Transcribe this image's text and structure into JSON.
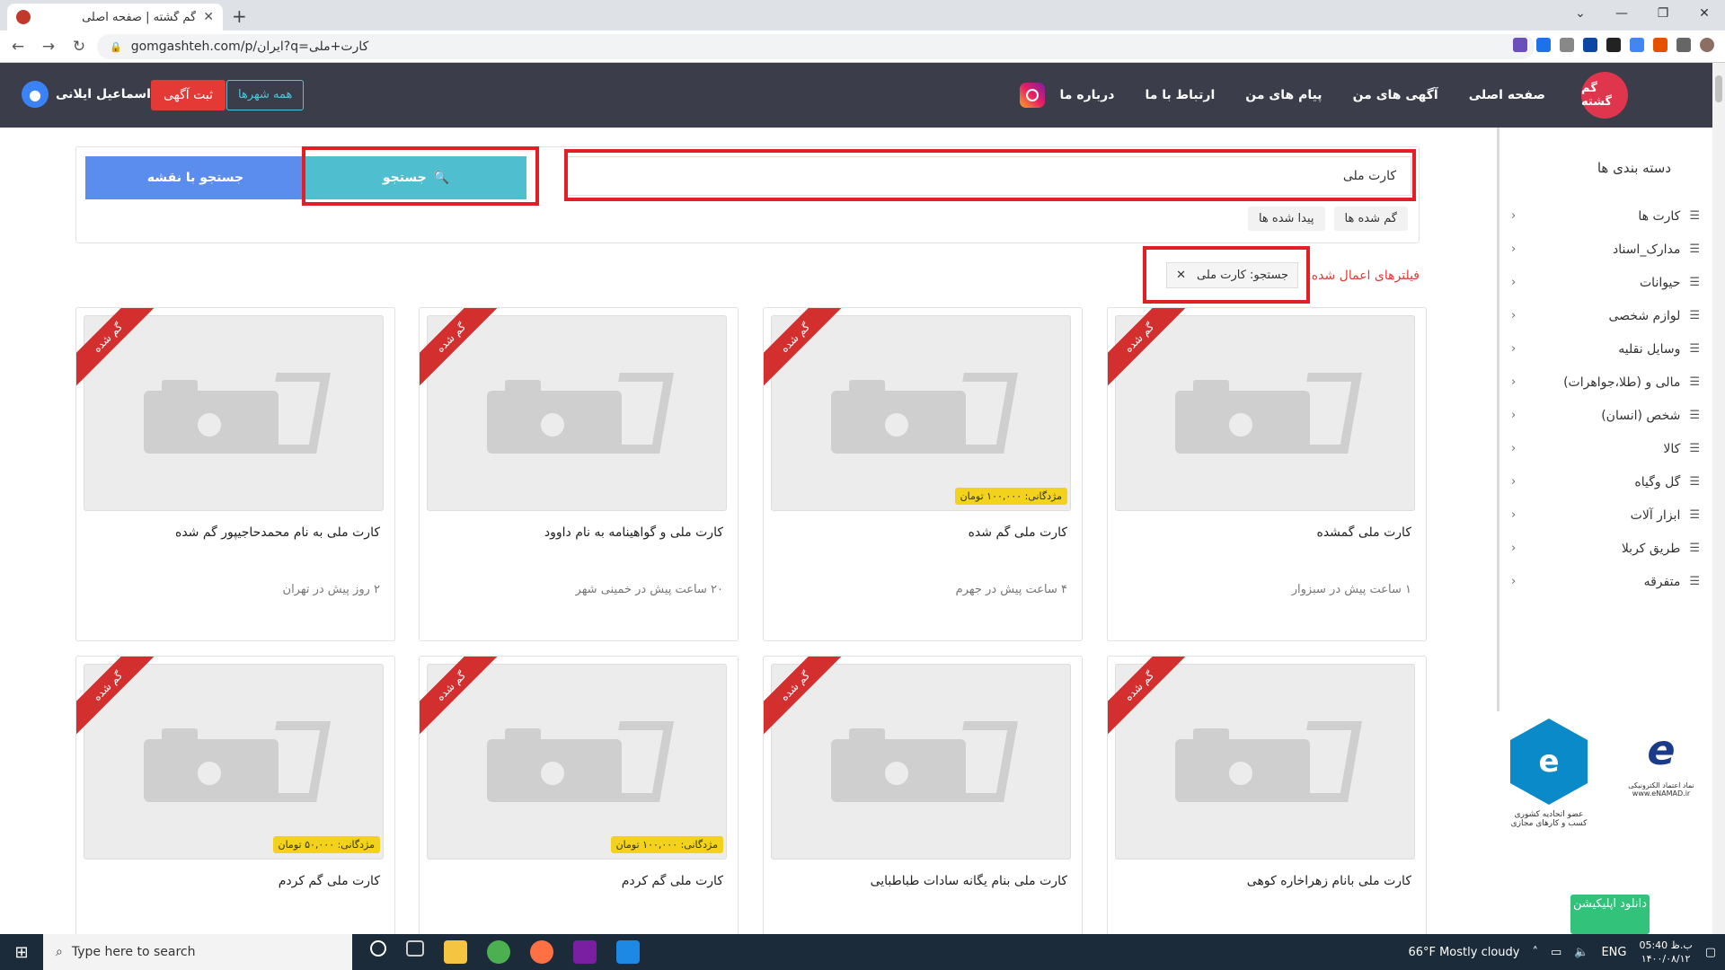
{
  "browser": {
    "tab_title": "گم گشته | صفحه اصلی",
    "url": "gomgashteh.com/p/ایران?q=کارت+ملی"
  },
  "header": {
    "logo": "گم گشته",
    "menu": [
      "صفحه اصلی",
      "آگهی های من",
      "پیام های من",
      "ارتباط با ما",
      "درباره ما"
    ],
    "user": "اسماعیل ایلانی",
    "post_ad": "ثبت آگهی",
    "all_cities": "همه شهرها"
  },
  "sidebar": {
    "title": "دسته بندی ها",
    "items": [
      "کارت ها",
      "مدارک_اسناد",
      "حیوانات",
      "لوازم شخصی",
      "وسایل نقلیه",
      "مالی و (طلا،جواهرات)",
      "شخص (انسان)",
      "کالا",
      "گل وگیاه",
      "ابزار آلات",
      "طریق کربلا",
      "متفرقه"
    ]
  },
  "badges": {
    "union": "عضو اتحادیه کشوری\nکسب و کارهای مجازی",
    "enamad": "نماد اعتماد الکترونیکی\nwww.eNAMAD.ir"
  },
  "download": "دانلود اپلیکیشن",
  "search": {
    "value": "کارت ملی",
    "button": "جستجو",
    "map": "جستجو با نقشه",
    "tabs": [
      "گم شده ها",
      "پیدا شده ها"
    ]
  },
  "filters": {
    "label": "فیلترهای اعمال شده:",
    "chip": "جستجو: کارت ملی"
  },
  "ribbon": "گم شده",
  "cards": [
    {
      "title": "کارت ملی گمشده",
      "meta": "۱ ساعت پیش در سبزوار",
      "reward": ""
    },
    {
      "title": "کارت ملی گم شده",
      "meta": "۴ ساعت پیش در جهرم",
      "reward": "مژدگانی: ۱۰۰,۰۰۰ تومان"
    },
    {
      "title": "کارت ملی و گواهینامه به نام داوود",
      "meta": "۲۰ ساعت پیش در خمینی شهر",
      "reward": ""
    },
    {
      "title": "کارت ملی به نام محمدحاجیپور گم شده",
      "meta": "۲ روز پیش در تهران",
      "reward": ""
    },
    {
      "title": "کارت ملی بانام زهراخاره کوهی",
      "meta": "",
      "reward": ""
    },
    {
      "title": "کارت ملی بنام یگانه سادات طباطبایی",
      "meta": "",
      "reward": ""
    },
    {
      "title": "کارت ملی گم کردم",
      "meta": "",
      "reward": "مژدگانی: ۱۰۰,۰۰۰ تومان"
    },
    {
      "title": "کارت ملی گم کردم",
      "meta": "",
      "reward": "مژدگانی: ۵۰,۰۰۰ تومان"
    }
  ],
  "taskbar": {
    "search": "Type here to search",
    "weather": "66°F  Mostly cloudy",
    "lang": "ENG",
    "time": "ب.ظ 05:40",
    "date": "۱۴۰۰/۰۸/۱۲"
  }
}
